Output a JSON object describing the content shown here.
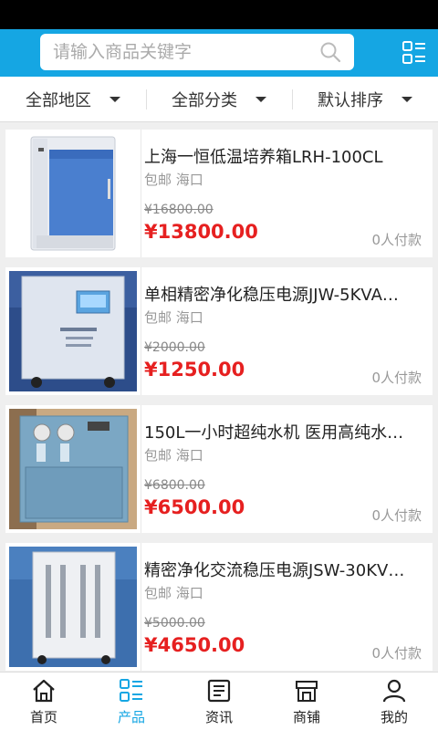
{
  "search": {
    "placeholder": "请输入商品关键字"
  },
  "filters": [
    {
      "label": "全部地区"
    },
    {
      "label": "全部分类"
    },
    {
      "label": "默认排序"
    }
  ],
  "products": [
    {
      "title": "上海一恒低温培养箱LRH-100CL",
      "shipping": "包邮",
      "location": "海口",
      "old_price": "¥16800.00",
      "price": "¥13800.00",
      "paid": "0人付款",
      "image": "incubator"
    },
    {
      "title": "单相精密净化稳压电源JJW-5KVA…",
      "shipping": "包邮",
      "location": "海口",
      "old_price": "¥2000.00",
      "price": "¥1250.00",
      "paid": "0人付款",
      "image": "power-supply"
    },
    {
      "title": "150L一小时超纯水机 医用高纯水…",
      "shipping": "包邮",
      "location": "海口",
      "old_price": "¥6800.00",
      "price": "¥6500.00",
      "paid": "0人付款",
      "image": "water-purifier"
    },
    {
      "title": "精密净化交流稳压电源JSW-30KV…",
      "shipping": "包邮",
      "location": "海口",
      "old_price": "¥5000.00",
      "price": "¥4650.00",
      "paid": "0人付款",
      "image": "ac-regulator"
    }
  ],
  "nav": [
    {
      "label": "首页",
      "icon": "home-icon"
    },
    {
      "label": "产品",
      "icon": "products-icon",
      "active": true
    },
    {
      "label": "资讯",
      "icon": "news-icon"
    },
    {
      "label": "商铺",
      "icon": "shop-icon"
    },
    {
      "label": "我的",
      "icon": "user-icon"
    }
  ],
  "colors": {
    "brand": "#15a6e3",
    "price": "#e62020"
  }
}
